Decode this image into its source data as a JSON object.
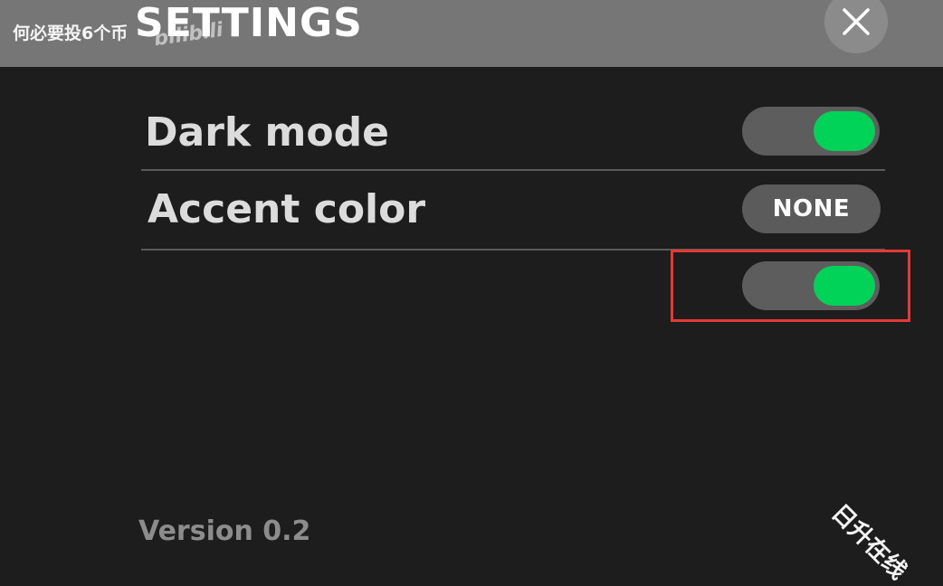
{
  "header": {
    "title": "SETTINGS",
    "overlay_text": "何必要投6个币",
    "overlay_logo": "bilibili",
    "close_icon": "close-icon"
  },
  "settings": {
    "dark_mode": {
      "label": "Dark mode",
      "enabled": true
    },
    "accent_color": {
      "label": "Accent color",
      "value": "NONE"
    },
    "unlabeled_toggle": {
      "enabled": true,
      "highlighted": true
    }
  },
  "footer": {
    "version": "Version 0.2"
  },
  "watermark": {
    "text": "日升在线"
  },
  "colors": {
    "background": "#1d1d1d",
    "header": "#767676",
    "toggle_on": "#00d357",
    "toggle_track": "#5d5d5d",
    "highlight": "#e53935"
  }
}
